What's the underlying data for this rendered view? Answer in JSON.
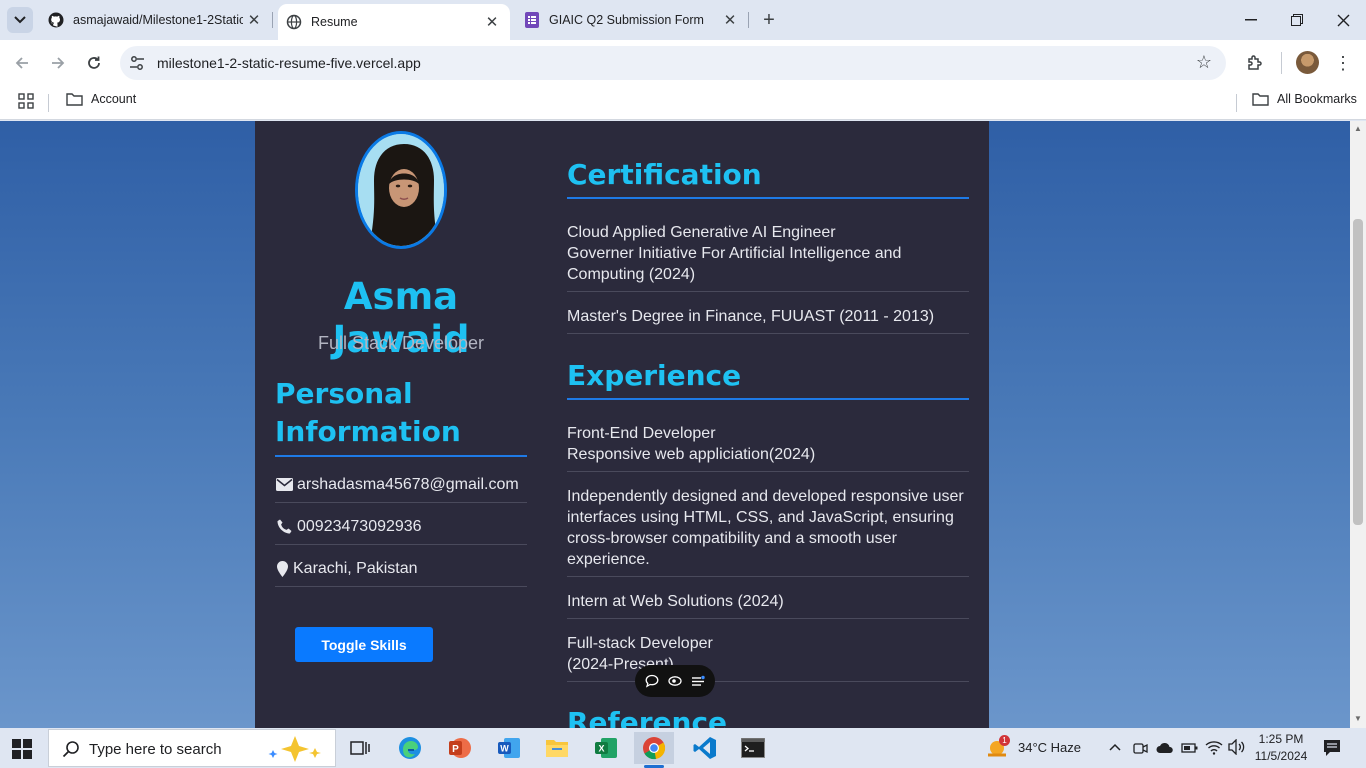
{
  "browser": {
    "tabs": [
      {
        "title": "asmajawaid/Milestone1-2Static"
      },
      {
        "title": "Resume"
      },
      {
        "title": "GIAIC Q2 Submission Form"
      }
    ],
    "url": "milestone1-2-static-resume-five.vercel.app",
    "bookmarks": {
      "account": "Account",
      "all_bookmarks": "All Bookmarks"
    }
  },
  "resume": {
    "name": "Asma Jawaid",
    "role": "Full Stack Developer",
    "personal_heading": "Personal Information",
    "contact": {
      "email": "arshadasma45678@gmail.com",
      "phone": "00923473092936",
      "location": "Karachi, Pakistan"
    },
    "toggle_skills_label": "Toggle Skills",
    "certification_heading": "Certification",
    "certifications": [
      {
        "line1": "Cloud Applied Generative AI Engineer",
        "line2": "Governer Initiative For Artificial Intelligence and Computing (2024)"
      },
      {
        "line1": "Master's Degree in Finance, FUUAST (2011 - 2013)",
        "line2": ""
      }
    ],
    "experience_heading": "Experience",
    "experience": [
      {
        "line1": "Front-End Developer",
        "line2": "Responsive web appliciation(2024)"
      },
      {
        "line1": "Independently designed and developed responsive user interfaces using HTML, CSS, and JavaScript, ensuring cross-browser compatibility and a smooth user experience.",
        "line2": ""
      },
      {
        "line1": "Intern at Web Solutions (2024)",
        "line2": ""
      },
      {
        "line1": "Full-stack Developer",
        "line2": "(2024-Present)"
      }
    ],
    "reference_heading": "Reference"
  },
  "taskbar": {
    "search_placeholder": "Type here to search",
    "weather": "34°C  Haze",
    "time": "1:25 PM",
    "date": "11/5/2024",
    "weather_badge": "1"
  },
  "colors": {
    "accent": "#1ec1f2",
    "heading_rule": "#1e7ae6",
    "resume_bg": "#2b2a3c",
    "button": "#0a7aff"
  }
}
